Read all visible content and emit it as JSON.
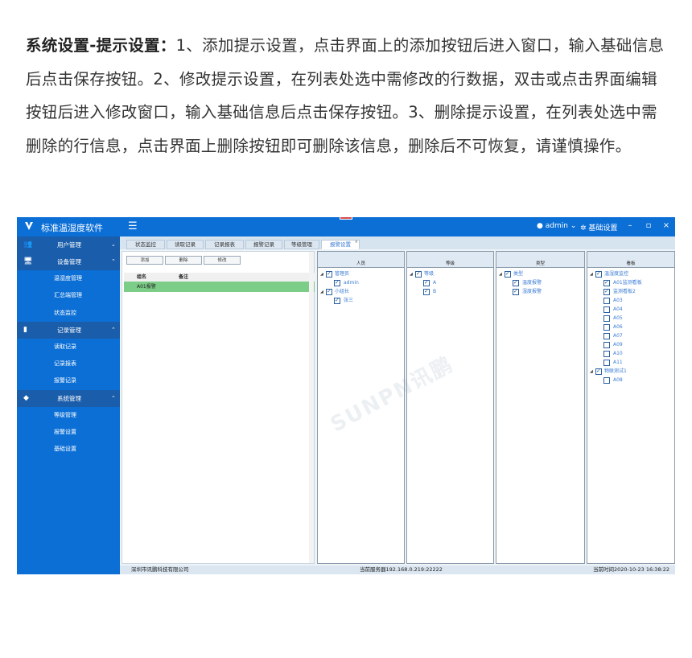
{
  "doc": {
    "bold_title": "系统设置-提示设置：",
    "text": "1、添加提示设置，点击界面上的添加按钮后进入窗口，输入基础信息后点击保存按钮。2、修改提示设置，在列表处选中需修改的行数据，双击或点击界面编辑按钮后进入修改窗口，输入基础信息后点击保存按钮。3、删除提示设置，在列表处选中需删除的行信息，点击界面上删除按钮即可删除该信息，删除后不可恢复，请谨慎操作。"
  },
  "app": {
    "title": "标准温湿度软件",
    "user": "admin",
    "settings": "基础设置",
    "win_min": "–",
    "win_restore": "▫",
    "win_close": "×"
  },
  "sidebar": {
    "sections": [
      {
        "label": "用户管理",
        "icon": "users-icon",
        "items": []
      },
      {
        "label": "设备管理",
        "icon": "monitor-icon",
        "items": [
          "温湿度管理",
          "汇总端管理",
          "状态监控"
        ]
      },
      {
        "label": "记录管理",
        "icon": "folder-icon",
        "items": [
          "读取记录",
          "记录报表",
          "报警记录"
        ]
      },
      {
        "label": "系统管理",
        "icon": "cube-icon",
        "items": [
          "等级管理",
          "报警设置",
          "基础设置"
        ]
      }
    ]
  },
  "tabs": [
    "状态监控",
    "读取记录",
    "记录报表",
    "报警记录",
    "等级管理",
    "报警设置"
  ],
  "active_tab": "报警设置",
  "toolbar": {
    "add": "添加",
    "delete": "删除",
    "edit": "修改"
  },
  "grid": {
    "headers": [
      "组名",
      "备注"
    ],
    "rows": [
      [
        "A01报警",
        ""
      ]
    ]
  },
  "panels": {
    "personnel": {
      "header": "人员",
      "tree": [
        {
          "label": "管理员",
          "children": [
            "admin"
          ]
        },
        {
          "label": "小组长",
          "children": [
            "张三"
          ]
        }
      ]
    },
    "level": {
      "header": "等级",
      "tree": [
        {
          "label": "等级",
          "children": [
            "A",
            "B"
          ]
        }
      ]
    },
    "type": {
      "header": "类型",
      "tree": [
        {
          "label": "类型",
          "children": [
            "温度报警",
            "湿度报警"
          ]
        }
      ]
    },
    "board": {
      "header": "看板",
      "tree": [
        {
          "label": "温湿度监控",
          "children": [
            "A01监测看板",
            "监测看板2",
            "A03",
            "A04",
            "A05",
            "A06",
            "A07",
            "A09",
            "A10",
            "A11"
          ],
          "checked": [
            true,
            true,
            false,
            false,
            false,
            false,
            false,
            false,
            false,
            false
          ]
        },
        {
          "label": "物联测试1",
          "children": [
            "A08"
          ],
          "checked": [
            false
          ]
        }
      ]
    }
  },
  "watermark": "SUNPN讯鹏",
  "status": {
    "company": "深圳市讯鹏科技有限公司",
    "server": "当前服务器192.168.0.219:22222",
    "time": "当前时间2020-10-23 16:38:22"
  }
}
